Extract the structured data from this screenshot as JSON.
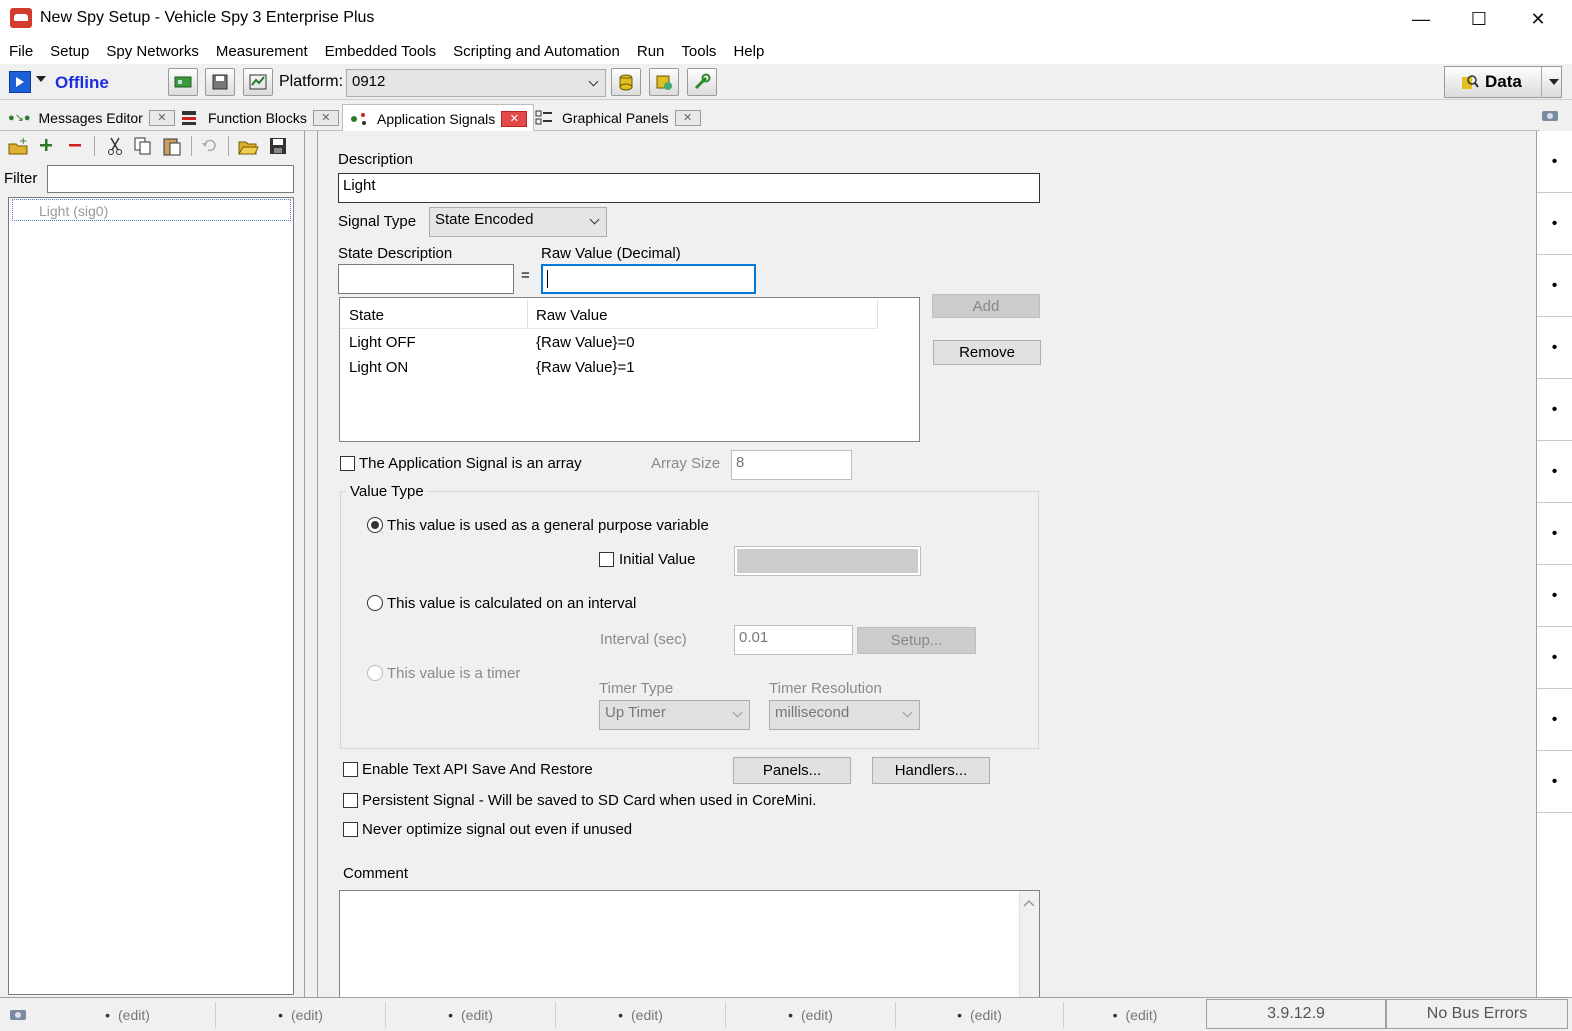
{
  "window": {
    "title": "New Spy Setup - Vehicle Spy 3 Enterprise Plus",
    "minimize": "—",
    "maximize": "☐",
    "close": "✕"
  },
  "menu": [
    "File",
    "Setup",
    "Spy Networks",
    "Measurement",
    "Embedded Tools",
    "Scripting and Automation",
    "Run",
    "Tools",
    "Help"
  ],
  "toolbar": {
    "status": "Offline",
    "platform_label": "Platform:",
    "platform_value": "0912",
    "data_label": "Data"
  },
  "tabs": [
    {
      "label": "Messages Editor"
    },
    {
      "label": "Function Blocks"
    },
    {
      "label": "Application Signals"
    },
    {
      "label": "Graphical Panels"
    }
  ],
  "left": {
    "filter_label": "Filter",
    "filter_value": "",
    "signals": [
      "Light (sig0)"
    ]
  },
  "form": {
    "description_label": "Description",
    "description_value": "Light",
    "signal_type_label": "Signal Type",
    "signal_type_value": "State Encoded",
    "state_desc_label": "State Description",
    "equals": "=",
    "raw_value_label": "Raw Value (Decimal)",
    "add_label": "Add",
    "remove_label": "Remove",
    "state_table": {
      "headers": [
        "State",
        "Raw Value"
      ],
      "rows": [
        [
          "Light OFF",
          "{Raw Value}=0"
        ],
        [
          "Light ON",
          "{Raw Value}=1"
        ]
      ]
    },
    "array_label": "The Application Signal is an array",
    "array_size_label": "Array Size",
    "array_size_value": "8",
    "value_type_legend": "Value Type",
    "general_purpose_label": "This value is used as a general purpose variable",
    "initial_value_label": "Initial Value",
    "interval_label": "This value is calculated on an interval",
    "interval_sec_label": "Interval (sec)",
    "interval_value": "0.01",
    "setup_label": "Setup...",
    "timer_label": "This value is a timer",
    "timer_type_label": "Timer Type",
    "timer_type_value": "Up Timer",
    "timer_res_label": "Timer Resolution",
    "timer_res_value": "millisecond",
    "text_api_label": "Enable Text API Save And Restore",
    "panels_label": "Panels...",
    "handlers_label": "Handlers...",
    "persistent_label": "Persistent Signal - Will be saved to SD Card when used in CoreMini.",
    "never_optimize_label": "Never optimize signal out even if unused",
    "comment_label": "Comment"
  },
  "rightstrip": {
    "dots": [
      "•",
      "•",
      "•",
      "•",
      "•",
      "•",
      "•",
      "•",
      "•",
      "•",
      "•"
    ]
  },
  "statusbar": {
    "cells": [
      "(edit)",
      "(edit)",
      "(edit)",
      "(edit)",
      "(edit)",
      "(edit)",
      "(edit)"
    ],
    "version": "3.9.12.9",
    "bus": "No Bus Errors"
  },
  "colors": {
    "accent_blue": "#1c2fd9",
    "close_tab_red": "#e24a4a",
    "app_icon_red": "#d23b2e"
  }
}
